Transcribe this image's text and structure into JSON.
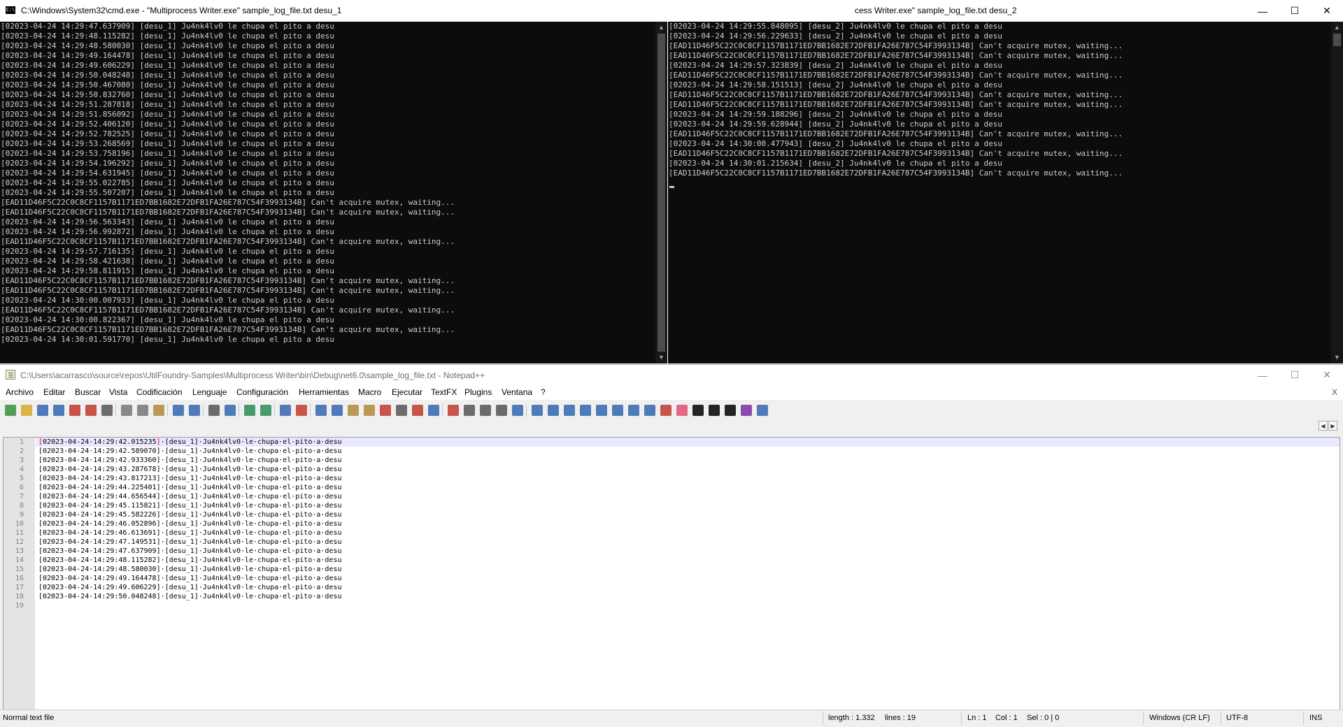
{
  "cmd1": {
    "title": "C:\\Windows\\System32\\cmd.exe - \"Multiprocess Writer.exe\"  sample_log_file.txt desu_1",
    "lines": [
      "[02023-04-24 14:29:47.637909] [desu_1] Ju4nk4lv0 le chupa el pito a desu",
      "[02023-04-24 14:29:48.115282] [desu_1] Ju4nk4lv0 le chupa el pito a desu",
      "[02023-04-24 14:29:48.580030] [desu_1] Ju4nk4lv0 le chupa el pito a desu",
      "[02023-04-24 14:29:49.164478] [desu_1] Ju4nk4lv0 le chupa el pito a desu",
      "[02023-04-24 14:29:49.606229] [desu_1] Ju4nk4lv0 le chupa el pito a desu",
      "[02023-04-24 14:29:50.048248] [desu_1] Ju4nk4lv0 le chupa el pito a desu",
      "[02023-04-24 14:29:50.467080] [desu_1] Ju4nk4lv0 le chupa el pito a desu",
      "[02023-04-24 14:29:50.832760] [desu_1] Ju4nk4lv0 le chupa el pito a desu",
      "[02023-04-24 14:29:51.287818] [desu_1] Ju4nk4lv0 le chupa el pito a desu",
      "[02023-04-24 14:29:51.856092] [desu_1] Ju4nk4lv0 le chupa el pito a desu",
      "[02023-04-24 14:29:52.406120] [desu_1] Ju4nk4lv0 le chupa el pito a desu",
      "[02023-04-24 14:29:52.782525] [desu_1] Ju4nk4lv0 le chupa el pito a desu",
      "[02023-04-24 14:29:53.268569] [desu_1] Ju4nk4lv0 le chupa el pito a desu",
      "[02023-04-24 14:29:53.758196] [desu_1] Ju4nk4lv0 le chupa el pito a desu",
      "[02023-04-24 14:29:54.196292] [desu_1] Ju4nk4lv0 le chupa el pito a desu",
      "[02023-04-24 14:29:54.631945] [desu_1] Ju4nk4lv0 le chupa el pito a desu",
      "[02023-04-24 14:29:55.022785] [desu_1] Ju4nk4lv0 le chupa el pito a desu",
      "[02023-04-24 14:29:55.507207] [desu_1] Ju4nk4lv0 le chupa el pito a desu",
      "[EAD11D46F5C22C0C8CF1157B1171ED7BB1682E72DFB1FA26E787C54F3993134B] Can't acquire mutex, waiting...",
      "[EAD11D46F5C22C0C8CF1157B1171ED7BB1682E72DFB1FA26E787C54F3993134B] Can't acquire mutex, waiting...",
      "[02023-04-24 14:29:56.563343] [desu_1] Ju4nk4lv0 le chupa el pito a desu",
      "[02023-04-24 14:29:56.992872] [desu_1] Ju4nk4lv0 le chupa el pito a desu",
      "[EAD11D46F5C22C0C8CF1157B1171ED7BB1682E72DFB1FA26E787C54F3993134B] Can't acquire mutex, waiting...",
      "[02023-04-24 14:29:57.716135] [desu_1] Ju4nk4lv0 le chupa el pito a desu",
      "[02023-04-24 14:29:58.421638] [desu_1] Ju4nk4lv0 le chupa el pito a desu",
      "[02023-04-24 14:29:58.811915] [desu_1] Ju4nk4lv0 le chupa el pito a desu",
      "[EAD11D46F5C22C0C8CF1157B1171ED7BB1682E72DFB1FA26E787C54F3993134B] Can't acquire mutex, waiting...",
      "[EAD11D46F5C22C0C8CF1157B1171ED7BB1682E72DFB1FA26E787C54F3993134B] Can't acquire mutex, waiting...",
      "[02023-04-24 14:30:00.007933] [desu_1] Ju4nk4lv0 le chupa el pito a desu",
      "[EAD11D46F5C22C0C8CF1157B1171ED7BB1682E72DFB1FA26E787C54F3993134B] Can't acquire mutex, waiting...",
      "[02023-04-24 14:30:00.822367] [desu_1] Ju4nk4lv0 le chupa el pito a desu",
      "[EAD11D46F5C22C0C8CF1157B1171ED7BB1682E72DFB1FA26E787C54F3993134B] Can't acquire mutex, waiting...",
      "[02023-04-24 14:30:01.591770] [desu_1] Ju4nk4lv0 le chupa el pito a desu"
    ]
  },
  "cmd2": {
    "title": "cess Writer.exe\"  sample_log_file.txt desu_2",
    "lines": [
      "[02023-04-24 14:29:55.848095] [desu_2] Ju4nk4lv0 le chupa el pito a desu",
      "[02023-04-24 14:29:56.229633] [desu_2] Ju4nk4lv0 le chupa el pito a desu",
      "[EAD11D46F5C22C0C8CF1157B1171ED7BB1682E72DFB1FA26E787C54F3993134B] Can't acquire mutex, waiting...",
      "[EAD11D46F5C22C0C8CF1157B1171ED7BB1682E72DFB1FA26E787C54F3993134B] Can't acquire mutex, waiting...",
      "[02023-04-24 14:29:57.323839] [desu_2] Ju4nk4lv0 le chupa el pito a desu",
      "[EAD11D46F5C22C0C8CF1157B1171ED7BB1682E72DFB1FA26E787C54F3993134B] Can't acquire mutex, waiting...",
      "[02023-04-24 14:29:58.151513] [desu_2] Ju4nk4lv0 le chupa el pito a desu",
      "[EAD11D46F5C22C0C8CF1157B1171ED7BB1682E72DFB1FA26E787C54F3993134B] Can't acquire mutex, waiting...",
      "[EAD11D46F5C22C0C8CF1157B1171ED7BB1682E72DFB1FA26E787C54F3993134B] Can't acquire mutex, waiting...",
      "[02023-04-24 14:29:59.188296] [desu_2] Ju4nk4lv0 le chupa el pito a desu",
      "[02023-04-24 14:29:59.628944] [desu_2] Ju4nk4lv0 le chupa el pito a desu",
      "[EAD11D46F5C22C0C8CF1157B1171ED7BB1682E72DFB1FA26E787C54F3993134B] Can't acquire mutex, waiting...",
      "[02023-04-24 14:30:00.477943] [desu_2] Ju4nk4lv0 le chupa el pito a desu",
      "[EAD11D46F5C22C0C8CF1157B1171ED7BB1682E72DFB1FA26E787C54F3993134B] Can't acquire mutex, waiting...",
      "[02023-04-24 14:30:01.215634] [desu_2] Ju4nk4lv0 le chupa el pito a desu",
      "[EAD11D46F5C22C0C8CF1157B1171ED7BB1682E72DFB1FA26E787C54F3993134B] Can't acquire mutex, waiting..."
    ],
    "controls": {
      "minimize": "—",
      "maximize": "☐",
      "close": "✕"
    }
  },
  "npp": {
    "title": "C:\\Users\\acarrasco\\source\\repos\\UtilFoundry-Samples\\Multiprocess Writer\\bin\\Debug\\net6.0\\sample_log_file.txt - Notepad++",
    "controls": {
      "minimize": "—",
      "maximize": "☐",
      "close": "✕"
    },
    "menu": [
      "Archivo",
      "Editar",
      "Buscar",
      "Vista",
      "Codificación",
      "Lenguaje",
      "Configuración",
      "Herramientas",
      "Macro",
      "Ejecutar",
      "TextFX",
      "Plugins",
      "Ventana",
      "?"
    ],
    "menu_close": "X",
    "tab_nav": {
      "prev": "◀",
      "next": "▶"
    },
    "lines": [
      "[02023-04-24·14:29:42.015235]·[desu_1]·Ju4nk4lv0·le·chupa·el·pito·a·desu",
      "[02023-04-24·14:29:42.589070]·[desu_1]·Ju4nk4lv0·le·chupa·el·pito·a·desu",
      "[02023-04-24·14:29:42.933360]·[desu_1]·Ju4nk4lv0·le·chupa·el·pito·a·desu",
      "[02023-04-24·14:29:43.287678]·[desu_1]·Ju4nk4lv0·le·chupa·el·pito·a·desu",
      "[02023-04-24·14:29:43.817213]·[desu_1]·Ju4nk4lv0·le·chupa·el·pito·a·desu",
      "[02023-04-24·14:29:44.225401]·[desu_1]·Ju4nk4lv0·le·chupa·el·pito·a·desu",
      "[02023-04-24·14:29:44.656544]·[desu_1]·Ju4nk4lv0·le·chupa·el·pito·a·desu",
      "[02023-04-24·14:29:45.115821]·[desu_1]·Ju4nk4lv0·le·chupa·el·pito·a·desu",
      "[02023-04-24·14:29:45.582226]·[desu_1]·Ju4nk4lv0·le·chupa·el·pito·a·desu",
      "[02023-04-24·14:29:46.052896]·[desu_1]·Ju4nk4lv0·le·chupa·el·pito·a·desu",
      "[02023-04-24·14:29:46.613691]·[desu_1]·Ju4nk4lv0·le·chupa·el·pito·a·desu",
      "[02023-04-24·14:29:47.149531]·[desu_1]·Ju4nk4lv0·le·chupa·el·pito·a·desu",
      "[02023-04-24·14:29:47.637909]·[desu_1]·Ju4nk4lv0·le·chupa·el·pito·a·desu",
      "[02023-04-24·14:29:48.115282]·[desu_1]·Ju4nk4lv0·le·chupa·el·pito·a·desu",
      "[02023-04-24·14:29:48.580030]·[desu_1]·Ju4nk4lv0·le·chupa·el·pito·a·desu",
      "[02023-04-24·14:29:49.164478]·[desu_1]·Ju4nk4lv0·le·chupa·el·pito·a·desu",
      "[02023-04-24·14:29:49.606229]·[desu_1]·Ju4nk4lv0·le·chupa·el·pito·a·desu",
      "[02023-04-24·14:29:50.048248]·[desu_1]·Ju4nk4lv0·le·chupa·el·pito·a·desu",
      ""
    ],
    "status": {
      "file_type": "Normal text file",
      "length": "length : 1.332",
      "lines": "lines : 19",
      "ln": "Ln : 1",
      "col": "Col : 1",
      "sel": "Sel : 0 | 0",
      "eol": "Windows (CR LF)",
      "encoding": "UTF-8",
      "mode": "INS"
    },
    "toolbar_icons": [
      "new-file-icon",
      "open-file-icon",
      "save-icon",
      "save-all-icon",
      "close-icon",
      "close-all-icon",
      "print-icon",
      "cut-icon",
      "copy-icon",
      "paste-icon",
      "undo-icon",
      "redo-icon",
      "find-icon",
      "replace-icon",
      "zoom-in-icon",
      "zoom-out-icon",
      "sync-vertical-icon",
      "sync-horizontal-icon",
      "word-wrap-icon",
      "show-all-chars-icon",
      "indent-guide-icon",
      "udl-icon",
      "function-list-icon",
      "doc-map-icon",
      "folder-workspace-icon",
      "monitoring-icon",
      "record-macro-icon",
      "stop-record-icon",
      "play-macro-icon",
      "run-macro-multiple-icon",
      "save-macro-icon",
      "plugin-1-icon",
      "plugin-2-icon",
      "plugin-3-icon",
      "plugin-4-icon",
      "move-up-icon",
      "move-down-icon",
      "plugin-5-icon",
      "plugin-6-icon",
      "plugin-7-icon",
      "heart-icon",
      "hex-h-icon",
      "json-icon",
      "markdown-md-icon",
      "markdown-mp-icon",
      "compare-icon"
    ]
  }
}
